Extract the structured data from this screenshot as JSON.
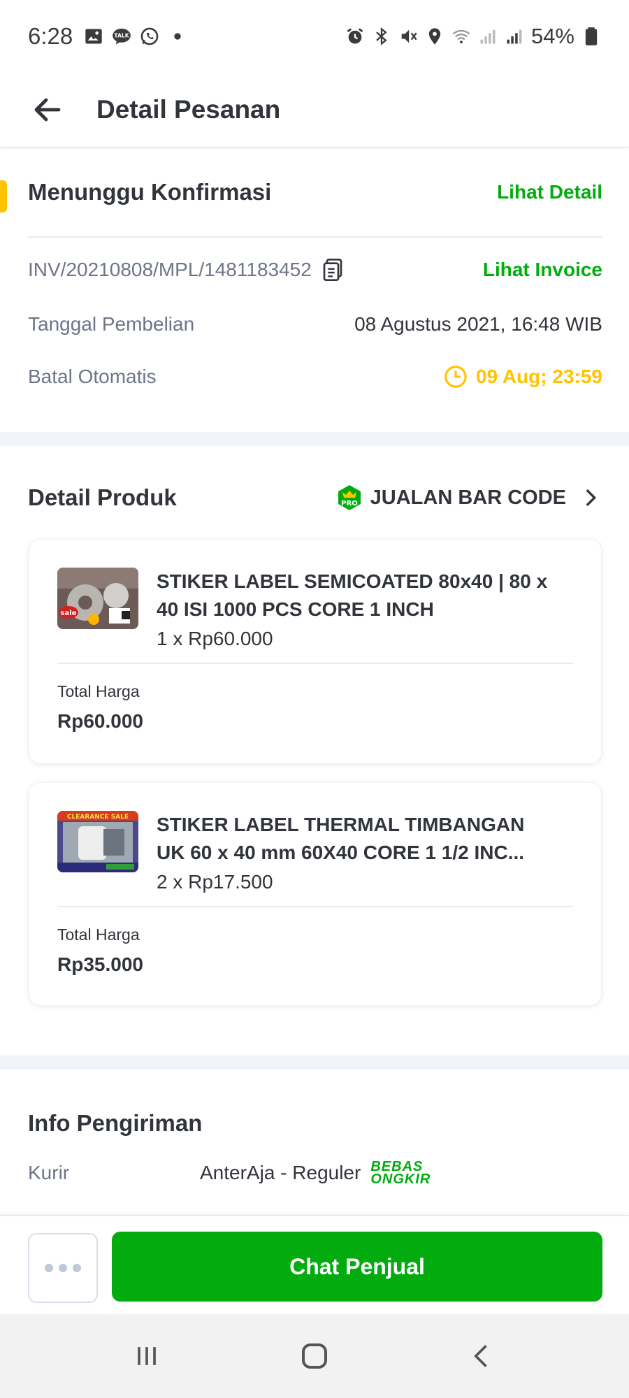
{
  "status_bar": {
    "time": "6:28",
    "battery": "54%",
    "left_icons": [
      "gallery-icon",
      "kakaotalk-icon",
      "whatsapp-icon",
      "notification-dot-icon"
    ],
    "right_icons": [
      "alarm-icon",
      "bluetooth-icon",
      "mute-icon",
      "location-icon",
      "wifi-icon",
      "signal-icon",
      "signal-r-icon",
      "battery-icon"
    ]
  },
  "header": {
    "title": "Detail Pesanan"
  },
  "order_status": {
    "title": "Menunggu Konfirmasi",
    "detail_link": "Lihat Detail",
    "invoice_number": "INV/20210808/MPL/1481183452",
    "invoice_link": "Lihat Invoice",
    "purchase_date_label": "Tanggal Pembelian",
    "purchase_date_value": "08 Agustus 2021, 16:48 WIB",
    "auto_cancel_label": "Batal Otomatis",
    "auto_cancel_value": "09 Aug; 23:59"
  },
  "products": {
    "section_title": "Detail Produk",
    "shop_badge": "PRO",
    "shop_name": "JUALAN BAR CODE",
    "items": [
      {
        "name_line1": "STIKER LABEL SEMICOATED 80x40 | 80 x",
        "name_line2": "40 ISI 1000 PCS CORE 1 INCH",
        "qty_price": "1 x Rp60.000",
        "total_label": "Total Harga",
        "total_value": "Rp60.000",
        "thumb_text": "sale"
      },
      {
        "name_line1": "STIKER LABEL THERMAL TIMBANGAN",
        "name_line2": "UK 60 x 40 mm 60X40 CORE 1 1/2 INC...",
        "qty_price": "2 x Rp17.500",
        "total_label": "Total Harga",
        "total_value": "Rp35.000",
        "thumb_text": "CLEARANCE SALE"
      }
    ]
  },
  "shipping": {
    "title": "Info Pengiriman",
    "courier_label": "Kurir",
    "courier_value": "AnterAja - Reguler",
    "badge_line1": "BEBAS",
    "badge_line2": "ONGKIR"
  },
  "actions": {
    "chat_label": "Chat Penjual"
  },
  "colors": {
    "primary_green": "#03ac0e",
    "warning_yellow": "#ffc400",
    "text_dark": "#31353b",
    "text_muted": "#6d7588"
  }
}
